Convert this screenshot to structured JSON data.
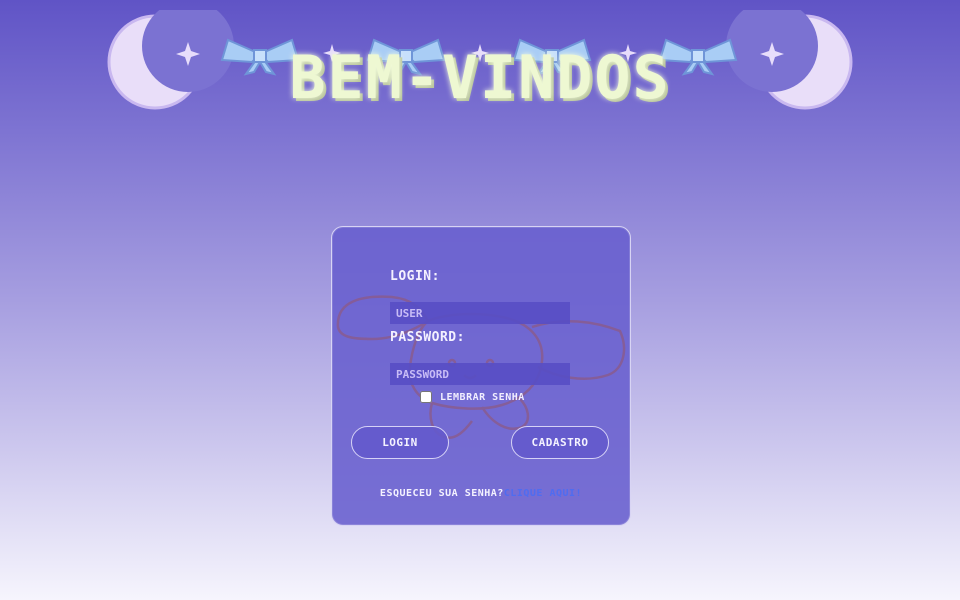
{
  "banner": {
    "title": "Bem-vindos"
  },
  "login_form": {
    "login_label": "LOGIN:",
    "user_placeholder": "USER",
    "user_value": "",
    "password_label": "PASSWORD:",
    "password_placeholder": "PASSWORD",
    "password_value": "",
    "remember_label": "LEMBRAR SENHA",
    "remember_checked": false,
    "login_button": "LOGIN",
    "signup_button": "CADASTRO",
    "forgot_text": "ESQUECEU SUA SENHA?",
    "forgot_link": "CLIQUE AQUI!"
  },
  "icons": {
    "moon_left": "crescent-moon-icon",
    "moon_right": "crescent-moon-icon",
    "bow": "bow-icon",
    "sparkle": "sparkle-icon",
    "mascot": "bunny-mascot-icon"
  },
  "colors": {
    "background_top": "#6054c6",
    "background_bottom": "#f6f5fd",
    "card": "#685ece",
    "banner_text": "#eef8d2",
    "moon": "#e8dcfa",
    "bow": "#a9cdf5",
    "link": "#4f6cf0"
  }
}
